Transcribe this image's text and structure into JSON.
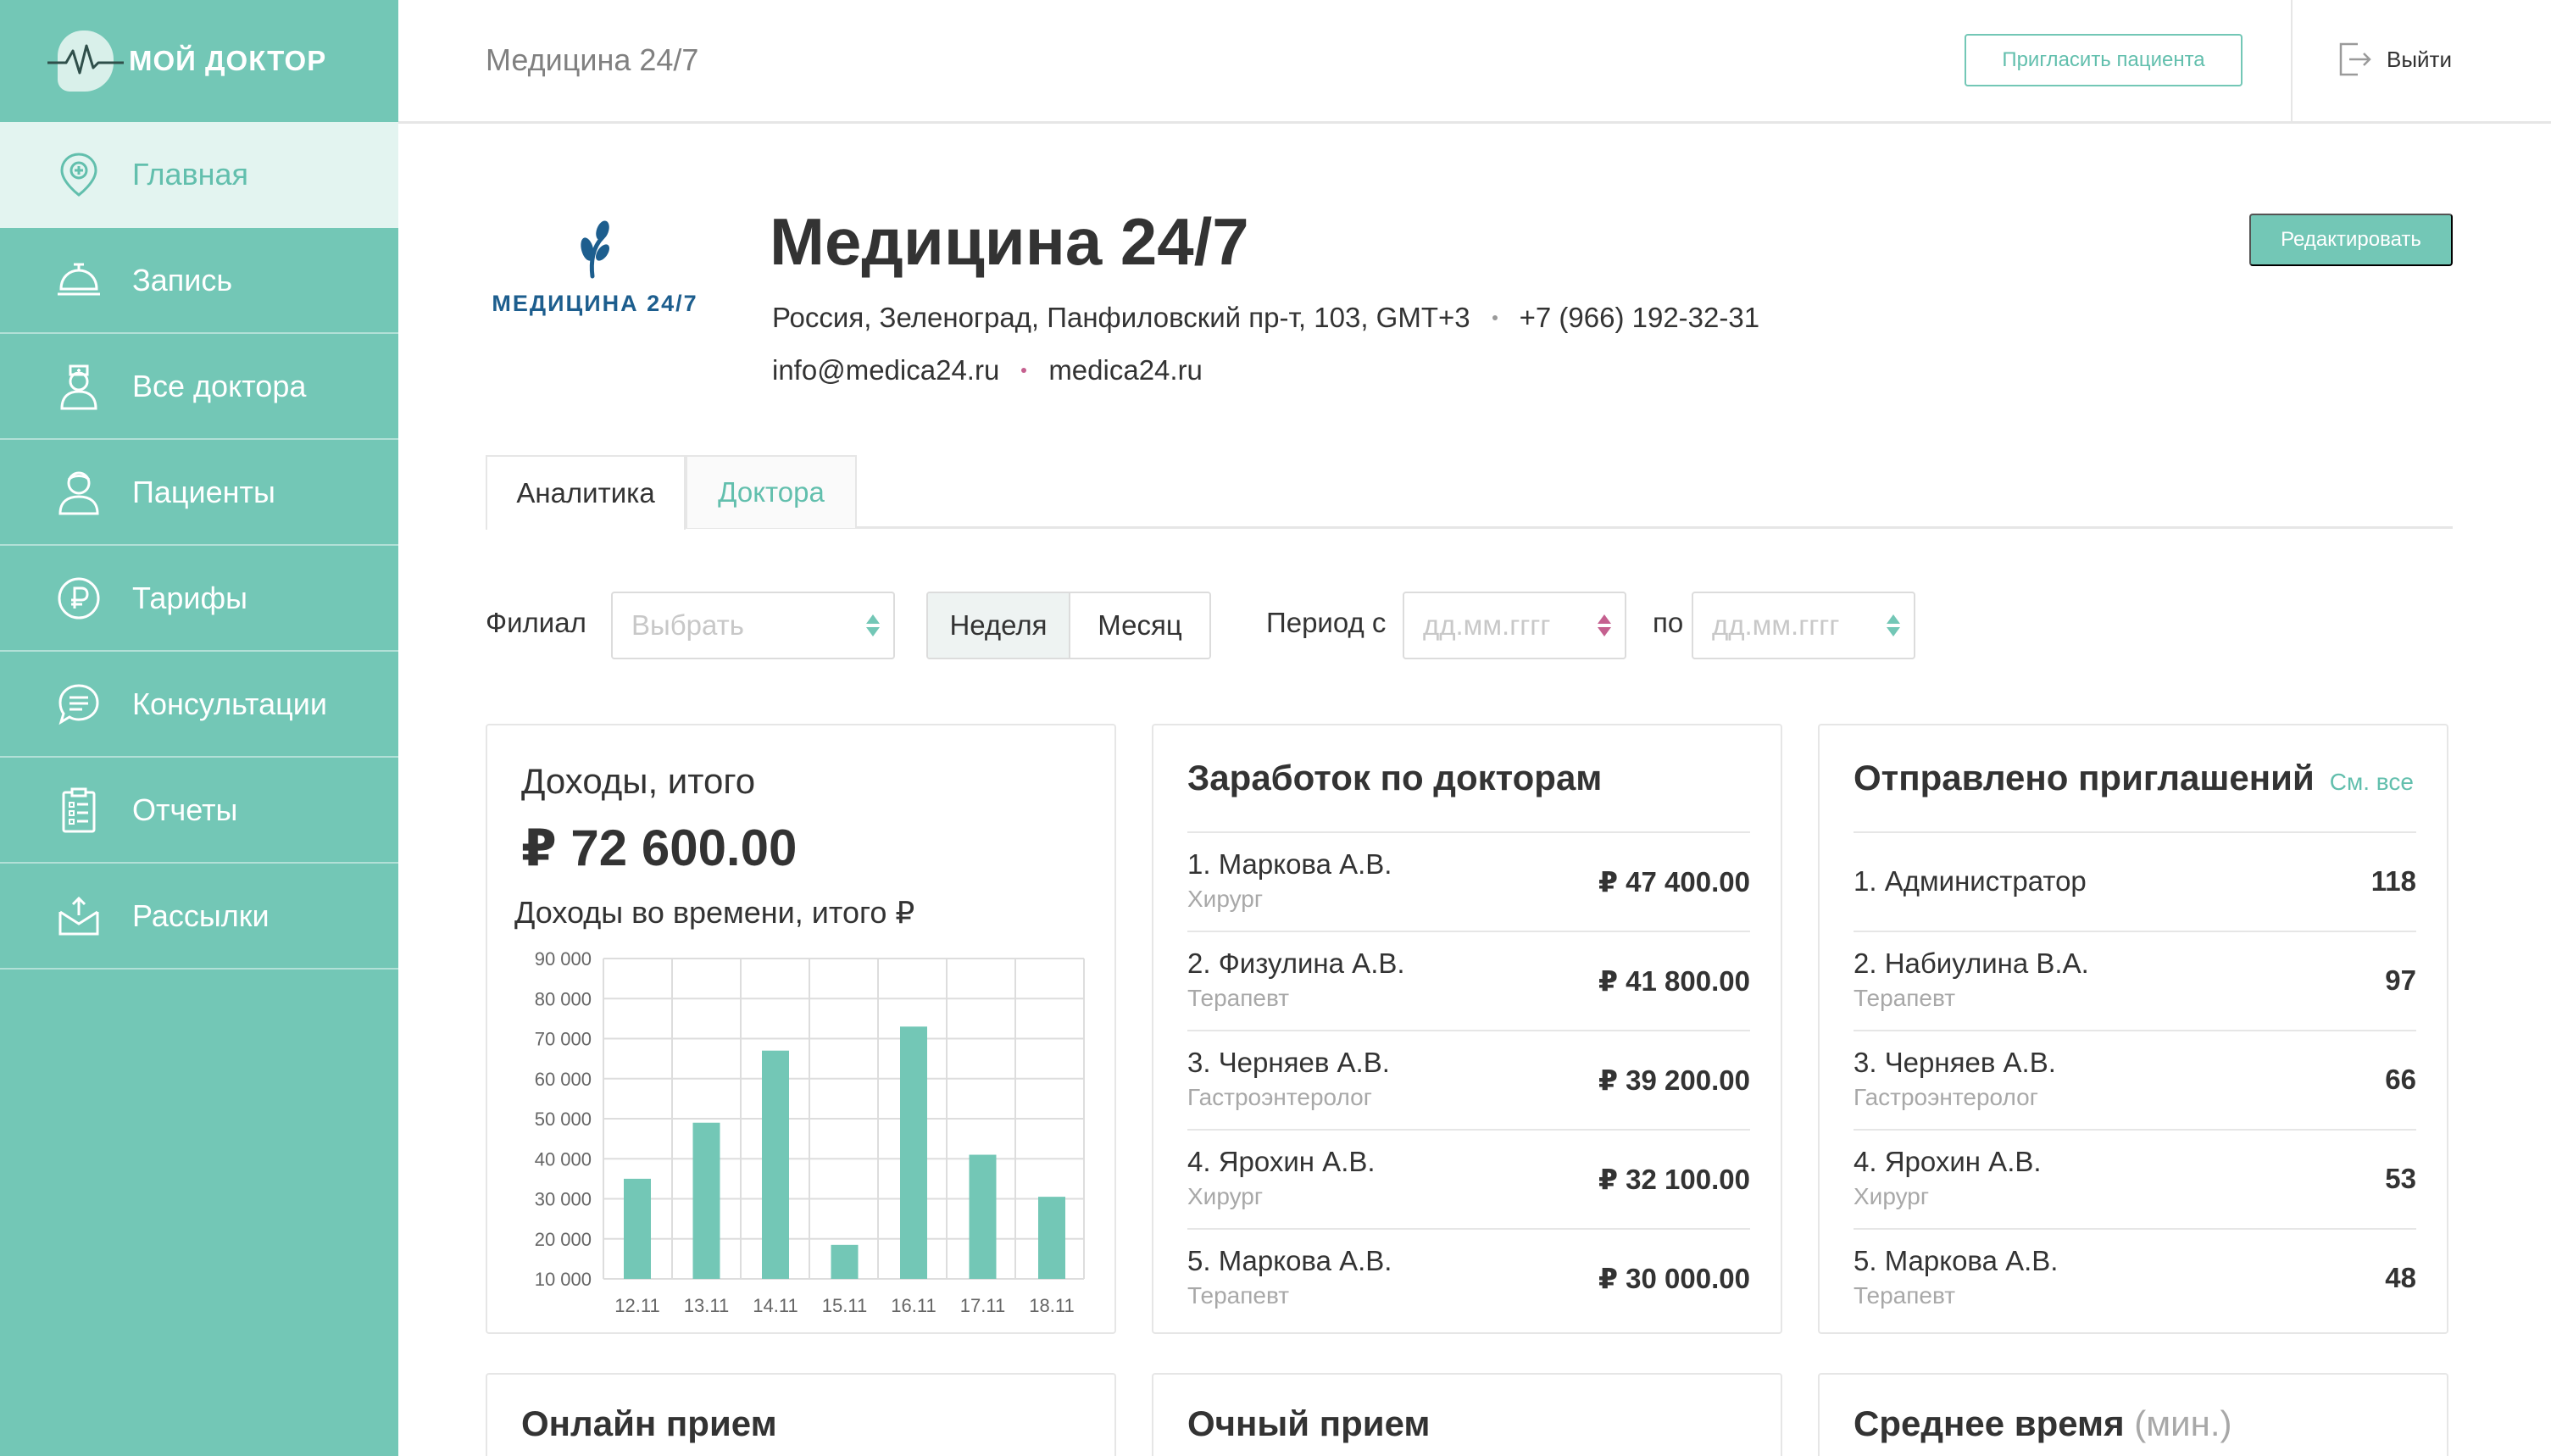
{
  "app": {
    "logo_text": "МОЙ ДОКТОР"
  },
  "sidebar": {
    "items": [
      {
        "label": "Главная",
        "icon": "map-pin-icon",
        "active": true
      },
      {
        "label": "Запись",
        "icon": "service-bell-icon",
        "active": false
      },
      {
        "label": "Все доктора",
        "icon": "doctor-icon",
        "active": false
      },
      {
        "label": "Пациенты",
        "icon": "patient-icon",
        "active": false
      },
      {
        "label": "Тарифы",
        "icon": "ruble-icon",
        "active": false
      },
      {
        "label": "Консультации",
        "icon": "chat-icon",
        "active": false
      },
      {
        "label": "Отчеты",
        "icon": "report-icon",
        "active": false
      },
      {
        "label": "Рассылки",
        "icon": "mail-tray-icon",
        "active": false
      }
    ]
  },
  "header": {
    "title": "Медицина 24/7",
    "invite_label": "Пригласить пациента",
    "logout_label": "Выйти"
  },
  "clinic": {
    "logo_label": "МЕДИЦИНА 24/7",
    "name": "Медицина 24/7",
    "address": "Россия, Зеленоград, Панфиловский пр-т, 103, GMT+3",
    "phone": "+7 (966) 192-32-31",
    "email": "info@medica24.ru",
    "site": "medica24.ru",
    "edit_label": "Редактировать"
  },
  "tabs": [
    {
      "label": "Аналитика",
      "active": true
    },
    {
      "label": "Доктора",
      "active": false
    }
  ],
  "filters": {
    "branch_label": "Филиал",
    "branch_placeholder": "Выбрать",
    "week_label": "Неделя",
    "month_label": "Месяц",
    "period_from_label": "Период с",
    "period_to_label": "по",
    "date_placeholder": "дд.мм.гггг"
  },
  "income_card": {
    "title": "Доходы, итого",
    "total": "₽ 72 600.00",
    "subtitle": "Доходы во времени, итого ₽"
  },
  "chart_data": {
    "type": "bar",
    "title": "Доходы во времени, итого ₽",
    "categories": [
      "12.11",
      "13.11",
      "14.11",
      "15.11",
      "16.11",
      "17.11",
      "18.11"
    ],
    "values": [
      35000,
      49000,
      67000,
      18500,
      73000,
      41000,
      30500
    ],
    "ylim": [
      10000,
      90000
    ],
    "y_ticks": [
      "10 000",
      "20 000",
      "30 000",
      "40 000",
      "50 000",
      "60 000",
      "70 000",
      "80 000",
      "90 000"
    ],
    "y_tick_values": [
      10000,
      20000,
      30000,
      40000,
      50000,
      60000,
      70000,
      80000,
      90000
    ],
    "grid": true,
    "bar_color": "#73c7b6"
  },
  "earnings_card": {
    "title": "Заработок по докторам",
    "rows": [
      {
        "name": "1. Маркова А.В.",
        "specialty": "Хирург",
        "value": "₽ 47 400.00"
      },
      {
        "name": "2. Физулина А.В.",
        "specialty": "Терапевт",
        "value": "₽ 41 800.00"
      },
      {
        "name": "3. Черняев А.В.",
        "specialty": "Гастроэнтеролог",
        "value": "₽ 39 200.00"
      },
      {
        "name": "4. Ярохин А.В.",
        "specialty": "Хирург",
        "value": "₽ 32 100.00"
      },
      {
        "name": "5. Маркова А.В.",
        "specialty": "Терапевт",
        "value": "₽ 30 000.00"
      }
    ]
  },
  "invites_card": {
    "title": "Отправлено приглашений",
    "see_all": "См. все",
    "rows": [
      {
        "name": "1. Администратор",
        "specialty": "",
        "value": "118"
      },
      {
        "name": "2. Набиулина В.А.",
        "specialty": "Терапевт",
        "value": "97"
      },
      {
        "name": "3. Черняев А.В.",
        "specialty": "Гастроэнтеролог",
        "value": "66"
      },
      {
        "name": "4. Ярохин А.В.",
        "specialty": "Хирург",
        "value": "53"
      },
      {
        "name": "5. Маркова А.В.",
        "specialty": "Терапевт",
        "value": "48"
      }
    ]
  },
  "bottom_cards": {
    "online": "Онлайн прием",
    "offline": "Очный прием",
    "avg_time": "Среднее время",
    "avg_time_unit": "(мин.)"
  },
  "colors": {
    "accent": "#73c7b6",
    "accent_text": "#62bfad",
    "active_nav_bg": "#e3f4f0",
    "logo_blue": "#1d5e8e",
    "dot_pink": "#c5608f"
  }
}
